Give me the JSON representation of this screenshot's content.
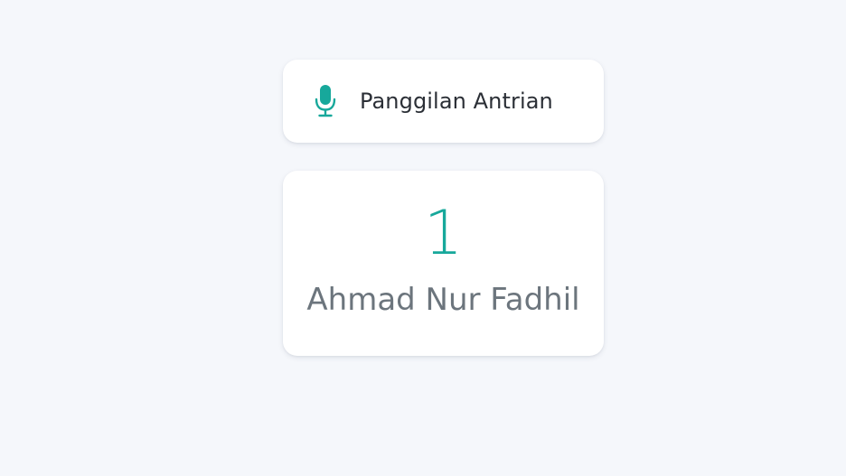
{
  "header": {
    "icon": "microphone-icon",
    "title": "Panggilan Antrian"
  },
  "queue": {
    "number": "1",
    "name": "Ahmad Nur Fadhil"
  },
  "colors": {
    "background": "#f5f7fb",
    "accent": "#17a89b",
    "title_text": "#2b2f36",
    "name_text": "#6c757d",
    "card": "#ffffff"
  }
}
